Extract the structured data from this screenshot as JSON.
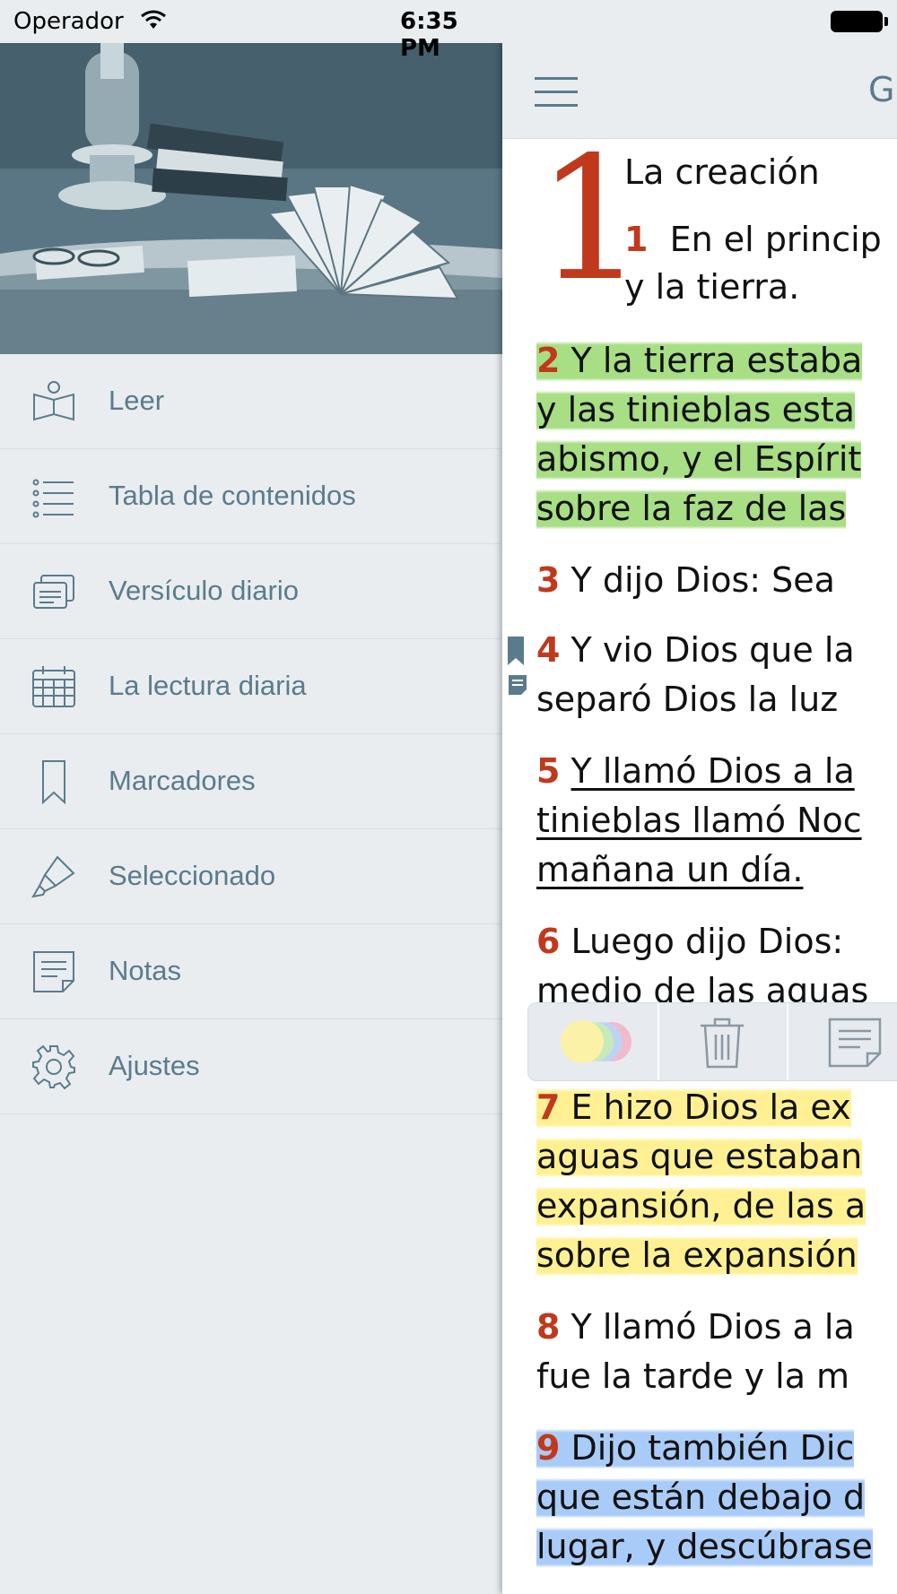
{
  "status_bar": {
    "carrier": "Operador",
    "time": "6:35 PM"
  },
  "drawer": {
    "hero_image": "still-life-lamp-books-illustration",
    "menu": [
      {
        "label": "Leer",
        "icon": "open-book-icon"
      },
      {
        "label": "Tabla de contenidos",
        "icon": "list-icon"
      },
      {
        "label": "Versículo diario",
        "icon": "cards-icon"
      },
      {
        "label": "La lectura diaria",
        "icon": "calendar-icon"
      },
      {
        "label": "Marcadores",
        "icon": "bookmark-icon"
      },
      {
        "label": "Seleccionado",
        "icon": "highlighter-icon"
      },
      {
        "label": "Notas",
        "icon": "note-icon"
      },
      {
        "label": "Ajustes",
        "icon": "gear-icon"
      }
    ]
  },
  "reader": {
    "title": "G",
    "chapter_number": "1",
    "heading": "La creación",
    "verses": {
      "v1": {
        "num": "1",
        "lines": [
          "En el princip",
          "y la tierra."
        ]
      },
      "v2": {
        "num": "2",
        "lines": [
          "Y la tierra estaba",
          "y las tinieblas esta",
          "abismo, y el Espírit",
          "sobre la faz de las"
        ]
      },
      "v3": {
        "num": "3",
        "lines": [
          "Y dijo Dios: Sea"
        ]
      },
      "v4": {
        "num": "4",
        "lines": [
          "Y vio Dios que la",
          "separó Dios la luz"
        ]
      },
      "v5": {
        "num": "5",
        "lines": [
          "Y llamó Dios a la",
          "tinieblas llamó Noc",
          "mañana un día."
        ]
      },
      "v6": {
        "num": "6",
        "lines": [
          "Luego dijo Dios:",
          "medio de las aguas"
        ]
      },
      "v7": {
        "num": "7",
        "lines": [
          "E hizo Dios la ex",
          "aguas que estaban",
          "expansión, de las a",
          "sobre la expansión"
        ]
      },
      "v8": {
        "num": "8",
        "lines": [
          "Y llamó Dios a la",
          "fue la tarde y la m"
        ]
      },
      "v9": {
        "num": "9",
        "lines": [
          "Dijo también Dic",
          "que están debajo d",
          "lugar, y descúbrase"
        ]
      }
    },
    "highlight_colors": {
      "green": "#a8de84",
      "yellow": "#fff193",
      "blue": "#a9cbf8"
    },
    "accent_color": "#c0391c"
  },
  "selection_toolbar": {
    "buttons": [
      "color-picker-icon",
      "trash-icon",
      "note-icon"
    ]
  }
}
